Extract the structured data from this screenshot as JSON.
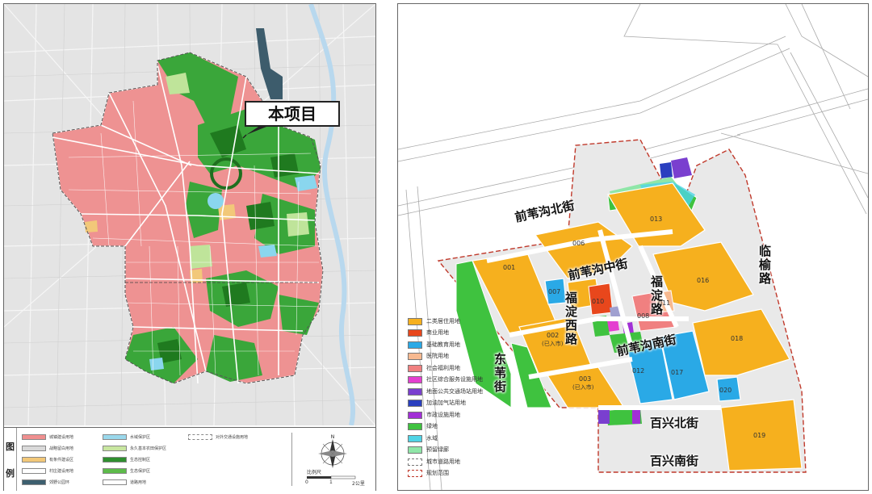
{
  "left_map": {
    "callout_label": "本项目",
    "legend_tag": [
      "图",
      "例"
    ],
    "legend_items": [
      {
        "label": "城镇建设用地",
        "color": "#ef8f8f"
      },
      {
        "label": "战略留白用地",
        "color": "#d9d9d9"
      },
      {
        "label": "有条件建设区",
        "color": "#f2c879"
      },
      {
        "label": "村庄建设用地",
        "color": "#ffffff"
      },
      {
        "label": "对外交通设施用地",
        "color": "#ffffff"
      },
      {
        "label": "水域保护区",
        "color": "#9ad8ec"
      },
      {
        "label": "永久基本农田保护区",
        "color": "#c8e6a0"
      },
      {
        "label": "生态控制区",
        "color": "#2f8f2f"
      },
      {
        "label": "生态保护区",
        "color": "#5dbb4a"
      },
      {
        "label": "道路用地",
        "color": "#ffffff"
      },
      {
        "label": "郊野公园环",
        "color": "#3d5f6f"
      }
    ],
    "scale_label": "比例尺",
    "scale_ticks": [
      "0",
      "1",
      "2公里"
    ]
  },
  "right_map": {
    "road_labels": {
      "qianweigou_north": "前苇沟北街",
      "qianweigou_middle": "前苇沟中街",
      "qianweigou_south": "前苇沟南街",
      "fudian_west": "福淀西路",
      "fudian": "福淀路",
      "dongwei": "东苇街",
      "linyu": "临榆路",
      "baixing_north": "百兴北街",
      "baixing_south": "百兴南街"
    },
    "lots": {
      "l001": "001",
      "l002": "002",
      "l003": "003",
      "l006": "006",
      "l007": "007",
      "l010": "010",
      "l011": "011",
      "l012": "012",
      "l013": "013",
      "l016": "016",
      "l017": "017",
      "l018": "018",
      "l019": "019",
      "l020": "020",
      "l008": "008",
      "l002_note": "(已入市)",
      "l003_note": "(已入市)"
    },
    "legend_items": [
      {
        "label": "二类居住用地",
        "color": "#f6b01e"
      },
      {
        "label": "商业用地",
        "color": "#e8471c"
      },
      {
        "label": "基础教育用地",
        "color": "#2aa9e6"
      },
      {
        "label": "医院用地",
        "color": "#f7b990"
      },
      {
        "label": "社会福利用地",
        "color": "#f08080"
      },
      {
        "label": "社区综合服务设施用地",
        "color": "#e43fd0"
      },
      {
        "label": "地面公共交通场站用地",
        "color": "#7a3fcf"
      },
      {
        "label": "加油加气站用地",
        "color": "#2a3fbf"
      },
      {
        "label": "市政设施用地",
        "color": "#a22fd6"
      },
      {
        "label": "绿地",
        "color": "#3fc23f"
      },
      {
        "label": "水域",
        "color": "#4fd4e6"
      },
      {
        "label": "预留绿廊",
        "color": "#8fe6a8"
      },
      {
        "label": "城市道路用地",
        "color": "#ffffff"
      },
      {
        "label": "规划范围",
        "color": "#c0392b"
      }
    ]
  }
}
